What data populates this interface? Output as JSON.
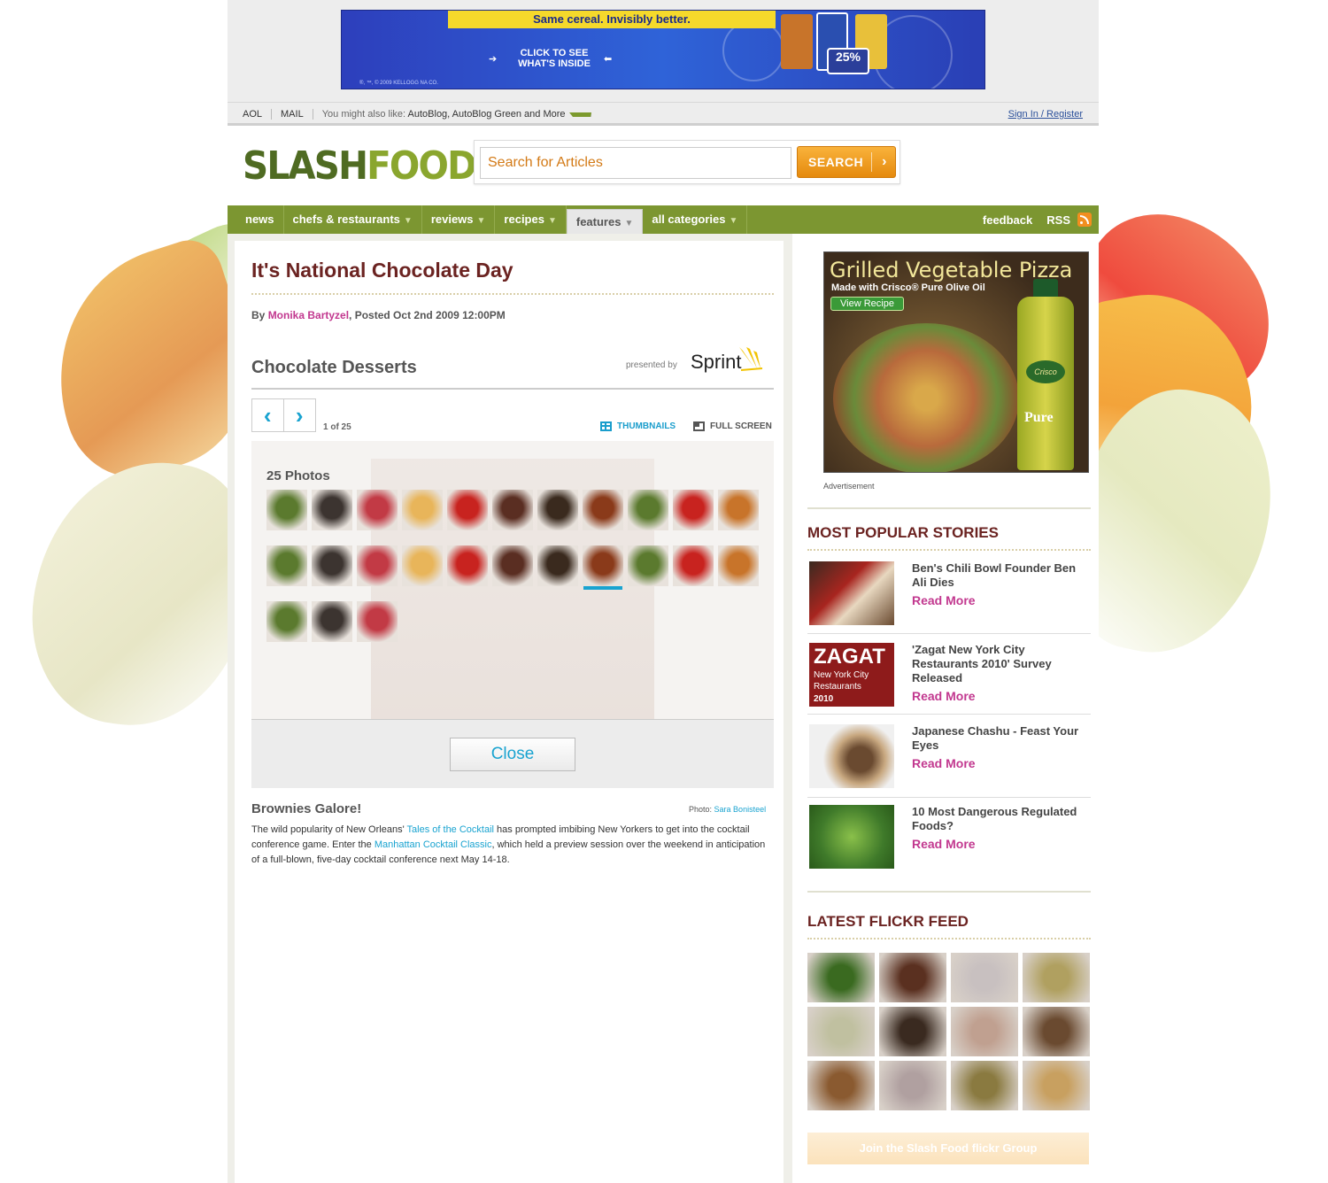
{
  "banner_ad": {
    "headline": "Same cereal. Invisibly better.",
    "cta": "CLICK TO SEE WHAT'S INSIDE",
    "badge": "25%",
    "copyright": "®, ™, © 2009 KELLOGG NA CO."
  },
  "topnav": {
    "items": [
      "AOL",
      "MAIL"
    ],
    "also_prefix": "You might also like:",
    "also_links": "AutoBlog, AutoBlog Green",
    "also_and": "and More",
    "signin": "Sign In / Register"
  },
  "header": {
    "logo_part1": "SLASH",
    "logo_part2": "FOOD",
    "search_placeholder": "Search for Articles",
    "search_button": "SEARCH"
  },
  "mainnav": {
    "tabs": [
      {
        "label": "news",
        "dropdown": false
      },
      {
        "label": "chefs & restaurants",
        "dropdown": true
      },
      {
        "label": "reviews",
        "dropdown": true
      },
      {
        "label": "recipes",
        "dropdown": true
      },
      {
        "label": "features",
        "dropdown": true,
        "active": true
      },
      {
        "label": "all categories",
        "dropdown": true
      }
    ],
    "feedback": "feedback",
    "rss": "RSS",
    "dropdown_glyph": "▼"
  },
  "article": {
    "title": "It's National Chocolate Day",
    "by": "By",
    "author": "Monika Bartyzel",
    "posted": ", Posted Oct 2nd 2009 12:00PM",
    "gallery_title": "Chocolate Desserts",
    "presented_by": "presented by",
    "sponsor": "Sprint",
    "counter": "1 of 25",
    "thumbnails_label": "THUMBNAILS",
    "fullscreen_label": "FULL SCREEN",
    "photo_count": "25 Photos",
    "close_label": "Close",
    "selected_index": 18,
    "caption_title": "Brownies Galore!",
    "photo_label": "Photo:",
    "photo_credit": "Sara Bonisteel",
    "caption_1": "The wild popularity of New Orleans' ",
    "caption_link1": "Tales of the Cocktail",
    "caption_2": " has prompted imbibing New Yorkers to get into the cocktail conference game. Enter the ",
    "caption_link2": "Manhattan Cocktail Classic",
    "caption_3": ", which held a preview session over the weekend in anticipation of a full-blown, five-day cocktail conference next May 14-18.",
    "thumb_colors": [
      "#5b7a2e",
      "#3c3430",
      "#c23a45",
      "#e8b55a",
      "#c8231f",
      "#5a2e22",
      "#3a2a1e",
      "#8a3a1a",
      "#5b7a2e",
      "#c8231f",
      "#c8742a",
      "#5b7a2e",
      "#3c3430",
      "#c23a45",
      "#e8b55a",
      "#c8231f",
      "#5a2e22",
      "#3a2a1e",
      "#8a3a1a",
      "#5b7a2e",
      "#c8231f",
      "#c8742a",
      "#5b7a2e",
      "#3c3430",
      "#c23a45"
    ]
  },
  "sidebar": {
    "ad_title": "Grilled Vegetable Pizza",
    "ad_sub": "Made with Crisco® Pure Olive Oil",
    "ad_cta": "View Recipe",
    "ad_brand": "Crisco",
    "ad_pure": "Pure",
    "ad_label": "Advertisement",
    "popular_title": "MOST POPULAR STORIES",
    "read_more": "Read More",
    "stories": [
      {
        "headline": "Ben's Chili Bowl Founder Ben Ali Dies",
        "color": "#a8251f"
      },
      {
        "headline": "'Zagat New York City Restaurants 2010' Survey Released",
        "color": "#8e1b1b"
      },
      {
        "headline": "Japanese Chashu - Feast Your Eyes",
        "color": "#6a4a30"
      },
      {
        "headline": "10 Most Dangerous Regulated Foods?",
        "color": "#3f7a2a"
      }
    ],
    "zagat_logo": "ZAGAT",
    "zagat_sub": "New York City Restaurants",
    "zagat_year": "2010",
    "flickr_title": "LATEST FLICKR FEED",
    "flickr_colors": [
      "#3a6a20",
      "#5a3020",
      "#c8c0c0",
      "#b0a060",
      "#c0c0a0",
      "#3a2a20",
      "#c0a090",
      "#6a4a30",
      "#8a5a30",
      "#b0a0a0",
      "#8a7a40",
      "#c8a060"
    ],
    "join_label": "Join the Slash Food flickr Group"
  },
  "colors": {
    "accent_green": "#7c9631",
    "title_maroon": "#6b2321",
    "link_blue": "#19a3d0",
    "author_pink": "#c2388f",
    "search_orange": "#f0a020"
  }
}
